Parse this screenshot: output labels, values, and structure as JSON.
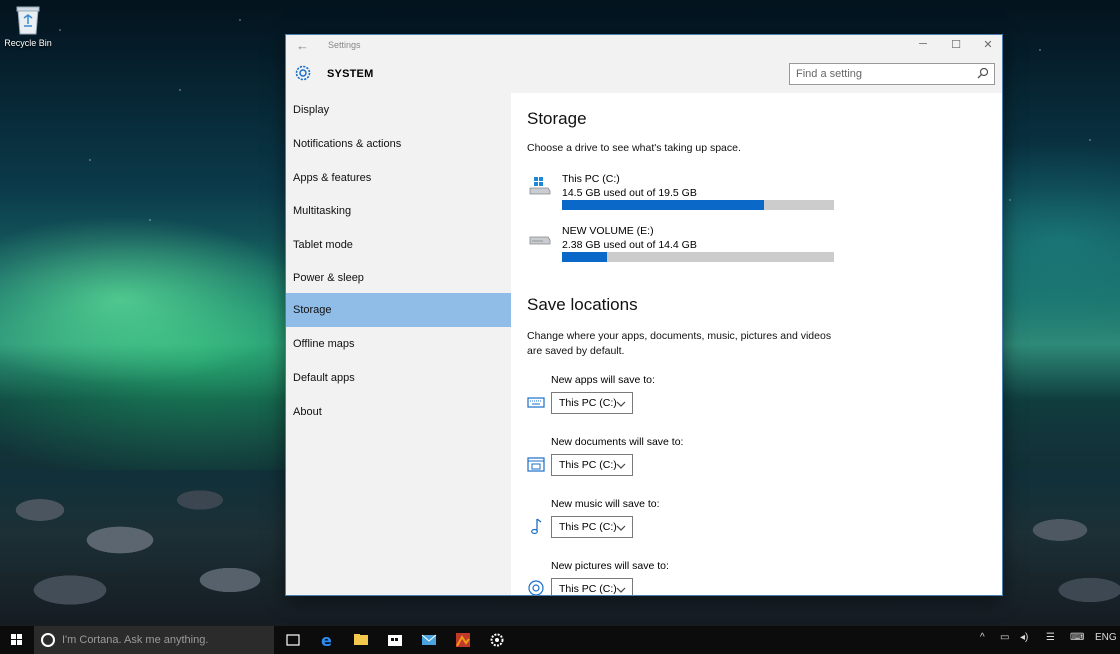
{
  "desktop": {
    "recycle_bin_label": "Recycle Bin"
  },
  "window": {
    "title": "Settings",
    "section_title": "SYSTEM",
    "search_placeholder": "Find a setting",
    "controls": {
      "minimize": "─",
      "maximize": "☐",
      "close": "✕"
    },
    "back_glyph": "←"
  },
  "sidebar": {
    "items": [
      {
        "label": "Display",
        "active": false
      },
      {
        "label": "Notifications & actions",
        "active": false
      },
      {
        "label": "Apps & features",
        "active": false
      },
      {
        "label": "Multitasking",
        "active": false
      },
      {
        "label": "Tablet mode",
        "active": false
      },
      {
        "label": "Power & sleep",
        "active": false
      },
      {
        "label": "Storage",
        "active": true
      },
      {
        "label": "Offline maps",
        "active": false
      },
      {
        "label": "Default apps",
        "active": false
      },
      {
        "label": "About",
        "active": false
      }
    ]
  },
  "storage": {
    "title": "Storage",
    "description": "Choose a drive to see what's taking up space.",
    "drives": [
      {
        "name": "This PC (C:)",
        "usage": "14.5 GB used out of 19.5 GB",
        "used_fraction": 0.744,
        "icon": "windows-drive-icon"
      },
      {
        "name": "NEW VOLUME (E:)",
        "usage": "2.38 GB used out of 14.4 GB",
        "used_fraction": 0.165,
        "icon": "hard-drive-icon"
      }
    ]
  },
  "save_locations": {
    "title": "Save locations",
    "description_line1": "Change where your apps, documents, music, pictures and videos",
    "description_line2": "are saved by default.",
    "items": [
      {
        "label": "New apps will save to:",
        "value": "This PC (C:)",
        "icon": "keyboard-icon"
      },
      {
        "label": "New documents will save to:",
        "value": "This PC (C:)",
        "icon": "documents-icon"
      },
      {
        "label": "New music will save to:",
        "value": "This PC (C:)",
        "icon": "music-note-icon"
      },
      {
        "label": "New pictures will save to:",
        "value": "This PC (C:)",
        "icon": "camera-icon"
      }
    ]
  },
  "taskbar": {
    "cortana_placeholder": "I'm Cortana. Ask me anything.",
    "language": "ENG",
    "accent_color": "#0a68c8",
    "selection_color": "#8fbde8"
  }
}
